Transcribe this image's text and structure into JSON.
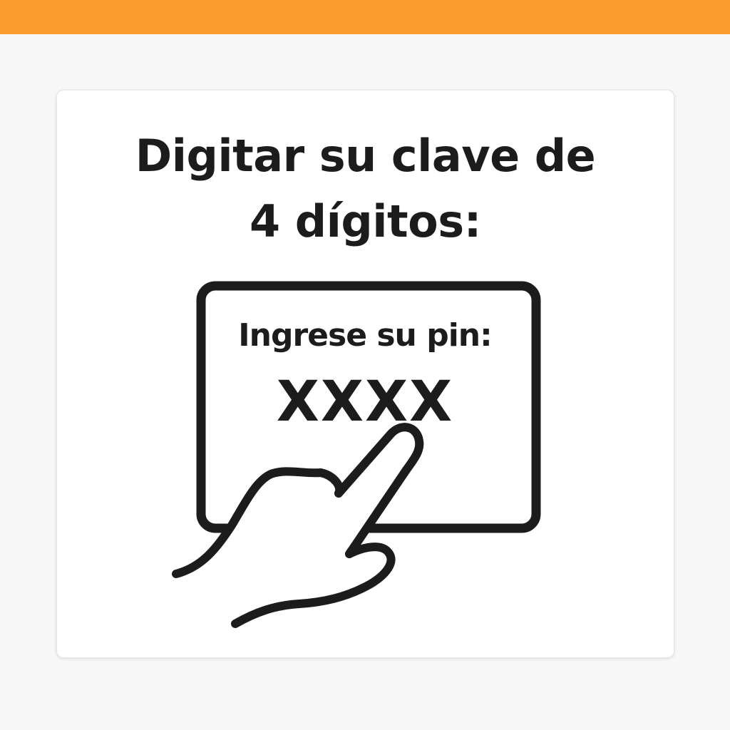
{
  "header": {
    "accent_color": "#fb9c2d"
  },
  "card": {
    "title_line1": "Digitar su clave de",
    "title_line2": "4 dígitos:",
    "illustration": {
      "icon": "hand-pressing-pin-pad-icon",
      "pin_label": "Ingrese su pin:",
      "pin_mask": "XXXX"
    }
  }
}
